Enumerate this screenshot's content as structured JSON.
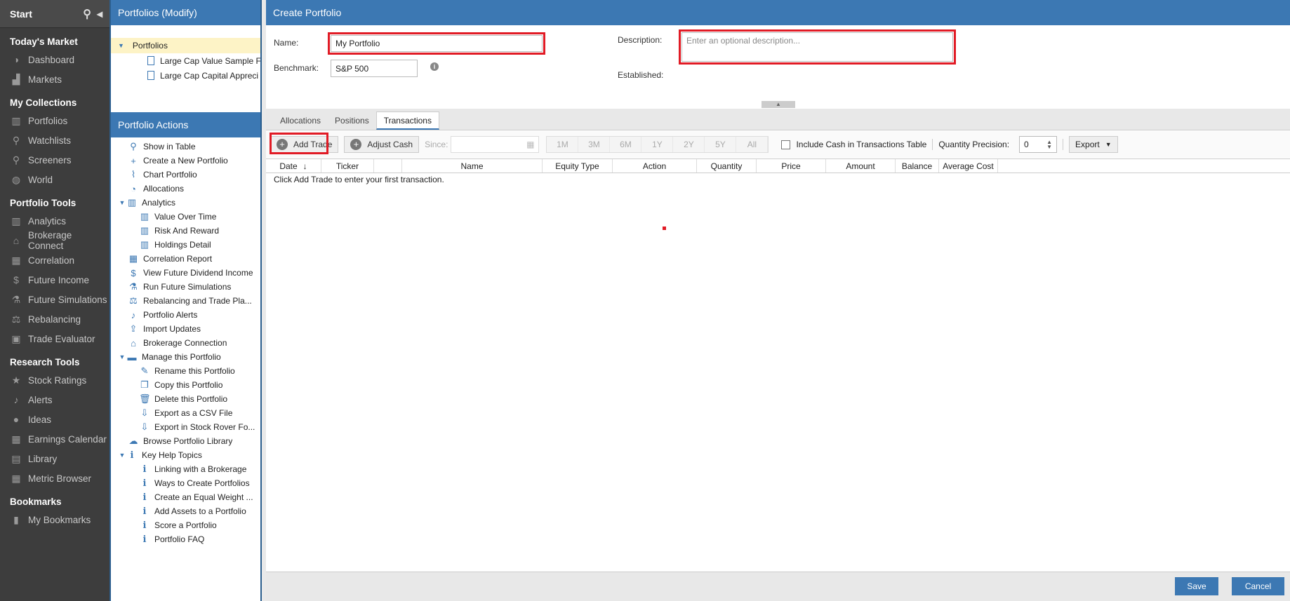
{
  "leftnav": {
    "title": "Start",
    "sections": [
      {
        "heading": "Today's Market",
        "items": [
          {
            "label": "Dashboard",
            "icon": "dashboard-icon"
          },
          {
            "label": "Markets",
            "icon": "chart-icon"
          }
        ]
      },
      {
        "heading": "My Collections",
        "items": [
          {
            "label": "Portfolios",
            "icon": "portfolio-icon"
          },
          {
            "label": "Watchlists",
            "icon": "binoculars-icon"
          },
          {
            "label": "Screeners",
            "icon": "search-icon"
          },
          {
            "label": "World",
            "icon": "globe-icon"
          }
        ]
      },
      {
        "heading": "Portfolio Tools",
        "items": [
          {
            "label": "Analytics",
            "icon": "bar-chart-icon"
          },
          {
            "label": "Brokerage Connect",
            "icon": "bank-icon"
          },
          {
            "label": "Correlation",
            "icon": "grid-icon"
          },
          {
            "label": "Future Income",
            "icon": "dollar-icon"
          },
          {
            "label": "Future Simulations",
            "icon": "flask-icon"
          },
          {
            "label": "Rebalancing",
            "icon": "scale-icon"
          },
          {
            "label": "Trade Evaluator",
            "icon": "briefcase-icon"
          }
        ]
      },
      {
        "heading": "Research Tools",
        "items": [
          {
            "label": "Stock Ratings",
            "icon": "star-icon"
          },
          {
            "label": "Alerts",
            "icon": "bell-icon"
          },
          {
            "label": "Ideas",
            "icon": "lightbulb-icon"
          },
          {
            "label": "Earnings Calendar",
            "icon": "calendar-icon"
          },
          {
            "label": "Library",
            "icon": "book-icon"
          },
          {
            "label": "Metric Browser",
            "icon": "table-icon"
          }
        ]
      },
      {
        "heading": "Bookmarks",
        "items": [
          {
            "label": "My Bookmarks",
            "icon": "bookmark-icon"
          }
        ]
      }
    ]
  },
  "portfolios_panel": {
    "title": "Portfolios (Modify)",
    "root": "Portfolios",
    "items": [
      "Large Cap Value Sample F",
      "Large Cap Capital Appreci"
    ]
  },
  "actions_panel": {
    "title": "Portfolio Actions",
    "items": [
      {
        "label": "Show in Table",
        "level": 0,
        "icon": "binoculars-icon",
        "glyph": "⚲"
      },
      {
        "label": "Create a New Portfolio",
        "level": 0,
        "icon": "plus-icon",
        "glyph": "+"
      },
      {
        "label": "Chart Portfolio",
        "level": 0,
        "icon": "line-chart-icon",
        "glyph": "⌇"
      },
      {
        "label": "Allocations",
        "level": 0,
        "icon": "pie-chart-icon",
        "glyph": "◔"
      },
      {
        "label": "Analytics",
        "level": 0,
        "toggle": true,
        "icon": "bar-chart-icon",
        "glyph": "▥"
      },
      {
        "label": "Value Over Time",
        "level": 1,
        "icon": "bar-chart-icon",
        "glyph": "▥"
      },
      {
        "label": "Risk And Reward",
        "level": 1,
        "icon": "bar-chart-icon",
        "glyph": "▥"
      },
      {
        "label": "Holdings Detail",
        "level": 1,
        "icon": "bar-chart-icon",
        "glyph": "▥"
      },
      {
        "label": "Correlation Report",
        "level": 0,
        "icon": "grid-icon",
        "glyph": "▦"
      },
      {
        "label": "View Future Dividend Income",
        "level": 0,
        "icon": "dollar-icon",
        "glyph": "$"
      },
      {
        "label": "Run Future Simulations",
        "level": 0,
        "icon": "flask-icon",
        "glyph": "⚗"
      },
      {
        "label": "Rebalancing and Trade Pla...",
        "level": 0,
        "icon": "scale-icon",
        "glyph": "⚖"
      },
      {
        "label": "Portfolio Alerts",
        "level": 0,
        "icon": "bell-icon",
        "glyph": "♪"
      },
      {
        "label": "Import Updates",
        "level": 0,
        "icon": "upload-icon",
        "glyph": "⇪"
      },
      {
        "label": "Brokerage Connection",
        "level": 0,
        "icon": "bank-icon",
        "glyph": "⌂"
      },
      {
        "label": "Manage this Portfolio",
        "level": 0,
        "toggle": true,
        "icon": "folder-icon",
        "glyph": "▬"
      },
      {
        "label": "Rename this Portfolio",
        "level": 1,
        "icon": "edit-icon",
        "glyph": "✎"
      },
      {
        "label": "Copy this Portfolio",
        "level": 1,
        "icon": "copy-icon",
        "glyph": "❐"
      },
      {
        "label": "Delete this Portfolio",
        "level": 1,
        "icon": "trash-icon",
        "glyph": "🗑"
      },
      {
        "label": "Export as a CSV File",
        "level": 1,
        "icon": "download-icon",
        "glyph": "⇩"
      },
      {
        "label": "Export in Stock Rover Fo...",
        "level": 1,
        "icon": "download-icon",
        "glyph": "⇩"
      },
      {
        "label": "Browse Portfolio Library",
        "level": 0,
        "icon": "cloud-download-icon",
        "glyph": "☁"
      },
      {
        "label": "Key Help Topics",
        "level": 0,
        "toggle": true,
        "icon": "info-icon",
        "glyph": "i"
      },
      {
        "label": "Linking with a Brokerage",
        "level": 1,
        "icon": "info-icon",
        "glyph": "i"
      },
      {
        "label": "Ways to Create Portfolios",
        "level": 1,
        "icon": "info-icon",
        "glyph": "i"
      },
      {
        "label": "Create an Equal Weight ...",
        "level": 1,
        "icon": "info-icon",
        "glyph": "i"
      },
      {
        "label": "Add Assets to a Portfolio",
        "level": 1,
        "icon": "info-icon",
        "glyph": "i"
      },
      {
        "label": "Score a Portfolio",
        "level": 1,
        "icon": "info-icon",
        "glyph": "i"
      },
      {
        "label": "Portfolio FAQ",
        "level": 1,
        "icon": "info-icon",
        "glyph": "i"
      }
    ]
  },
  "create_portfolio": {
    "title": "Create Portfolio",
    "name_label": "Name:",
    "name_value": "My Portfolio",
    "benchmark_label": "Benchmark:",
    "benchmark_value": "S&P 500",
    "description_label": "Description:",
    "description_placeholder": "Enter an optional description...",
    "established_label": "Established:"
  },
  "tabs": [
    "Allocations",
    "Positions",
    "Transactions"
  ],
  "active_tab": "Transactions",
  "toolbar": {
    "add_trade": "Add Trade",
    "adjust_cash": "Adjust Cash",
    "since_label": "Since:",
    "periods": [
      "1M",
      "3M",
      "6M",
      "1Y",
      "2Y",
      "5Y",
      "All"
    ],
    "include_cash": "Include Cash in Transactions Table",
    "quantity_precision_label": "Quantity Precision:",
    "quantity_precision_value": "0",
    "export": "Export"
  },
  "table": {
    "columns": [
      "Date",
      "Ticker",
      "",
      "Name",
      "Equity Type",
      "Action",
      "Quantity",
      "Price",
      "Amount",
      "Balance",
      "Average Cost"
    ],
    "empty_message": "Click Add Trade to enter your first transaction."
  },
  "footer": {
    "save": "Save",
    "cancel": "Cancel"
  },
  "colors": {
    "accent": "#3c78b3",
    "highlight": "#e11b25",
    "nav_bg": "#3d3d3d"
  }
}
